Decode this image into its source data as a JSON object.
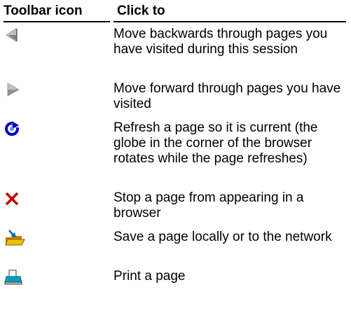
{
  "table": {
    "headers": {
      "icon": "Toolbar icon",
      "action": "Click to"
    },
    "rows": [
      {
        "icon": "back-arrow-icon",
        "description": "Move backwards through pages you have visited during this session"
      },
      {
        "icon": "forward-arrow-icon",
        "description": "Move forward through pages you have visited"
      },
      {
        "icon": "refresh-icon",
        "description": "Refresh a page so it is current (the globe in the corner of the browser rotates while the page refreshes)"
      },
      {
        "icon": "stop-icon",
        "description": "Stop a page from appearing in a browser"
      },
      {
        "icon": "save-icon",
        "description": "Save a page locally or to the network"
      },
      {
        "icon": "print-icon",
        "description": "Print a page"
      }
    ]
  },
  "colors": {
    "back_arrow": "#808080",
    "forward_arrow": "#808080",
    "refresh": "#0000c0",
    "stop": "#c00000",
    "save_folder": "#f0c000",
    "print": "#00a0c0"
  }
}
